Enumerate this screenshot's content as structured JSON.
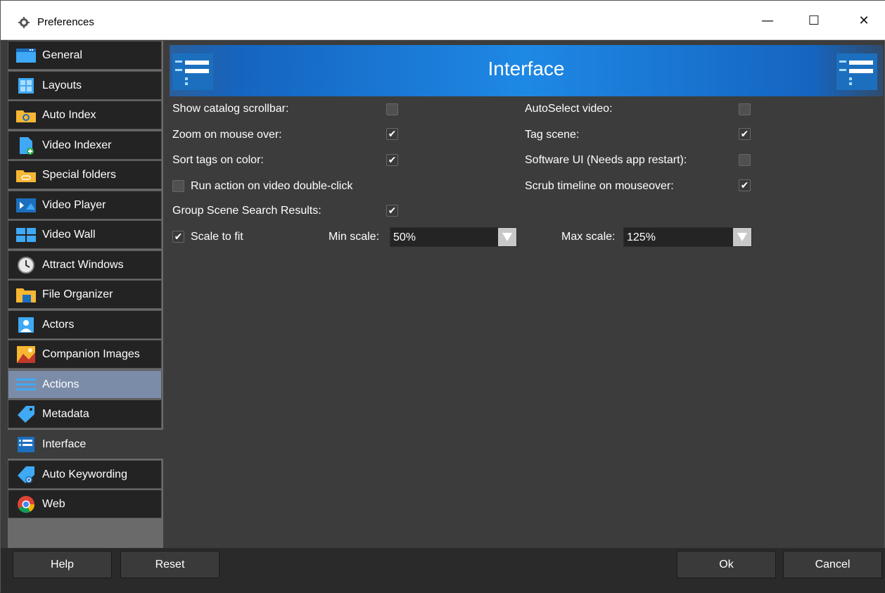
{
  "window": {
    "title": "Preferences",
    "minimize": "—",
    "maximize": "☐",
    "close": "✕"
  },
  "sidebar": {
    "items": [
      {
        "label": "General",
        "icon": "general-icon"
      },
      {
        "label": "Layouts",
        "icon": "layouts-icon"
      },
      {
        "label": "Auto Index",
        "icon": "auto-index-icon"
      },
      {
        "label": "Video Indexer",
        "icon": "video-indexer-icon"
      },
      {
        "label": "Special folders",
        "icon": "special-folders-icon"
      },
      {
        "label": "Video Player",
        "icon": "video-player-icon"
      },
      {
        "label": "Video Wall",
        "icon": "video-wall-icon"
      },
      {
        "label": "Attract Windows",
        "icon": "clock-icon"
      },
      {
        "label": "File Organizer",
        "icon": "file-organizer-icon"
      },
      {
        "label": "Actors",
        "icon": "actor-icon"
      },
      {
        "label": "Companion Images",
        "icon": "image-icon"
      },
      {
        "label": "Actions",
        "icon": "actions-icon",
        "state": "hover"
      },
      {
        "label": "Metadata",
        "icon": "tag-icon"
      },
      {
        "label": "Interface",
        "icon": "interface-icon",
        "state": "selected"
      },
      {
        "label": "Auto Keywording",
        "icon": "auto-tag-icon"
      },
      {
        "label": "Web",
        "icon": "chrome-icon"
      }
    ]
  },
  "header": {
    "title": "Interface"
  },
  "settings": {
    "show_catalog_scrollbar": {
      "label": "Show catalog scrollbar:",
      "checked": false
    },
    "zoom_on_mouse_over": {
      "label": "Zoom on mouse over:",
      "checked": true
    },
    "sort_tags_on_color": {
      "label": "Sort tags on color:",
      "checked": true
    },
    "run_action_double_click": {
      "label": "Run action on video double-click",
      "checked": false
    },
    "group_scene_search": {
      "label": "Group Scene Search Results:",
      "checked": true
    },
    "scale_to_fit": {
      "label": "Scale to fit",
      "checked": true
    },
    "min_scale": {
      "label": "Min scale:",
      "value": "50%"
    },
    "max_scale": {
      "label": "Max scale:",
      "value": "125%"
    },
    "autoselect_video": {
      "label": "AutoSelect video:",
      "checked": false
    },
    "tag_scene": {
      "label": "Tag scene:",
      "checked": true
    },
    "software_ui": {
      "label": "Software UI (Needs app restart):",
      "checked": false
    },
    "scrub_timeline": {
      "label": "Scrub timeline on mouseover:",
      "checked": true
    }
  },
  "buttons": {
    "help": "Help",
    "reset": "Reset",
    "ok": "Ok",
    "cancel": "Cancel"
  },
  "colors": {
    "banner": "#1e88e5",
    "background": "#3c3c3c",
    "nav_item": "#232323",
    "nav_hover": "#7b8ca8"
  }
}
